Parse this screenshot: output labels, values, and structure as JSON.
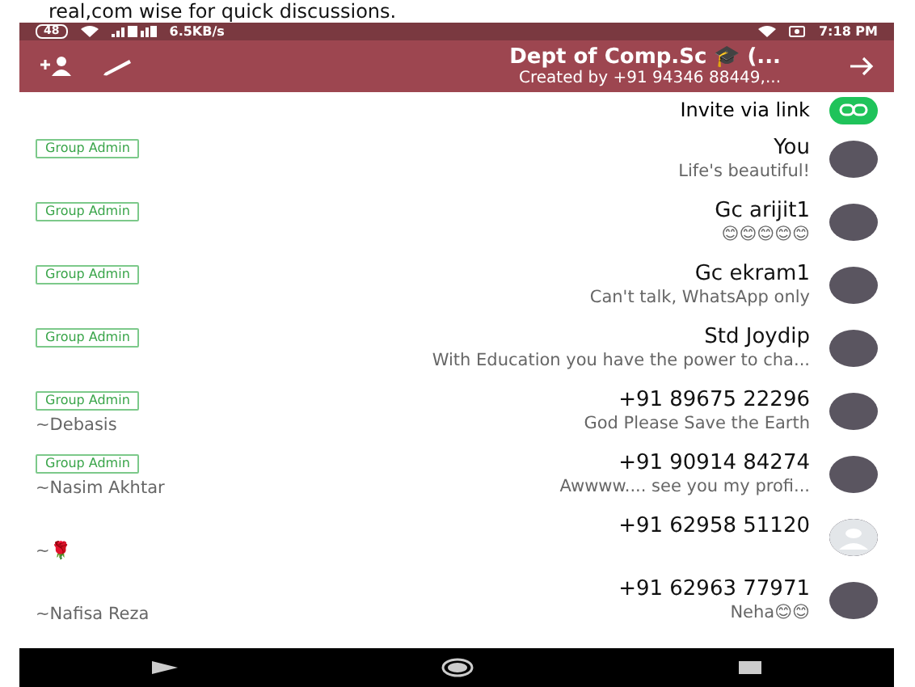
{
  "caption": "real,com wise for quick discussions.",
  "status_bar": {
    "time": "7:18 PM",
    "speed": "6.5KB/s",
    "battery": "48"
  },
  "header": {
    "title": "Dept of Comp.Sc 🎓 (...",
    "subtitle": "Created by +91 94346 88449,..."
  },
  "invite": {
    "label": "Invite via link"
  },
  "members": [
    {
      "name": "You",
      "status": "Life's beautiful!",
      "admin_label": "Group Admin",
      "photo": true
    },
    {
      "name": "Gc arijit1",
      "status": "😊😊😊😊😊",
      "admin_label": "Group Admin",
      "photo": true
    },
    {
      "name": "Gc ekram1",
      "status": "Can't talk, WhatsApp only",
      "admin_label": "Group Admin",
      "photo": true
    },
    {
      "name": "Std Joydip",
      "status": "With Education you have the power to cha...",
      "admin_label": "Group Admin",
      "photo": true
    },
    {
      "name": "+91 89675 22296",
      "status": "God Please Save the Earth",
      "admin_label": "Group Admin",
      "push_name": "~Debasis",
      "photo": true
    },
    {
      "name": "+91 90914 84274",
      "status": "Awwww.... see you my profi...",
      "admin_label": "Group Admin",
      "push_name": "~Nasim Akhtar",
      "photo": true
    },
    {
      "name": "+91 62958 51120",
      "push_name": "~🌹",
      "photo": false
    },
    {
      "name": "+91 62963 77971",
      "status": "Neha😊😊",
      "push_name": "~Nafisa Reza",
      "photo": true
    }
  ]
}
